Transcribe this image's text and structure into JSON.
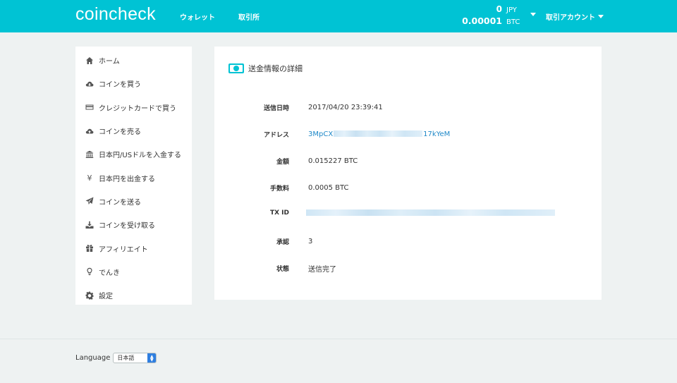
{
  "header": {
    "logo": "coincheck",
    "nav": {
      "wallet": "ウォレット",
      "exchange": "取引所"
    },
    "balance": [
      {
        "amount": "0",
        "unit": "JPY"
      },
      {
        "amount": "0.00001",
        "unit": "BTC"
      }
    ],
    "account_label": "取引アカウント",
    "accent_color": "#00c3d4"
  },
  "sidebar": {
    "items": [
      {
        "label": "ホーム",
        "icon": "home-icon"
      },
      {
        "label": "コインを買う",
        "icon": "cloud-download-icon"
      },
      {
        "label": "クレジットカードで買う",
        "icon": "credit-card-icon"
      },
      {
        "label": "コインを売る",
        "icon": "cloud-upload-icon"
      },
      {
        "label": "日本円/USドルを入金する",
        "icon": "bank-icon"
      },
      {
        "label": "日本円を出金する",
        "icon": "yen-icon"
      },
      {
        "label": "コインを送る",
        "icon": "paper-plane-icon"
      },
      {
        "label": "コインを受け取る",
        "icon": "download-tray-icon"
      },
      {
        "label": "アフィリエイト",
        "icon": "gift-icon"
      },
      {
        "label": "でんき",
        "icon": "lightbulb-icon"
      },
      {
        "label": "設定",
        "icon": "gear-icon"
      }
    ]
  },
  "panel": {
    "title": "送金情報の詳細",
    "fields": {
      "datetime": {
        "label": "送信日時",
        "value": "2017/04/20 23:39:41"
      },
      "address": {
        "label": "アドレス",
        "prefix": "3MpCX",
        "suffix": "17kYeM"
      },
      "amount": {
        "label": "金額",
        "value": "0.015227 BTC"
      },
      "fee": {
        "label": "手数料",
        "value": "0.0005 BTC"
      },
      "txid": {
        "label": "TX ID"
      },
      "confirmations": {
        "label": "承認",
        "value": "3"
      },
      "status": {
        "label": "状態",
        "value": "送信完了"
      }
    },
    "link_color": "#1e88c8"
  },
  "footer": {
    "language_label": "Language",
    "language_selected": "日本語"
  }
}
